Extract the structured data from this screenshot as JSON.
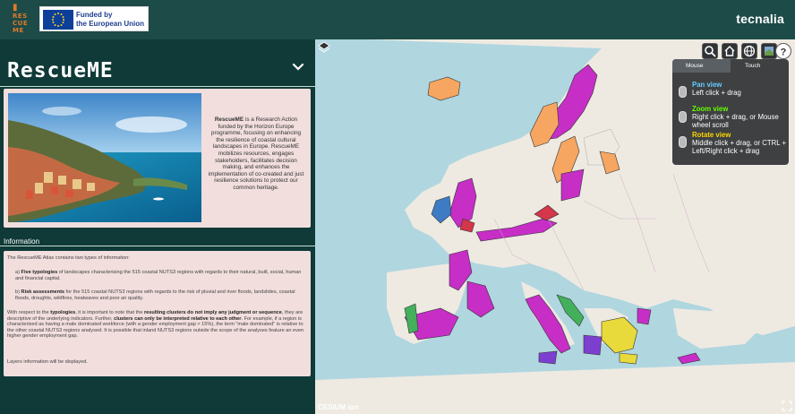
{
  "header": {
    "logo_lines": [
      "RES",
      "CUE",
      "ME"
    ],
    "eu_text_line1": "Funded by",
    "eu_text_line2": "the European Union",
    "partner_brand": "tecnalia"
  },
  "panel": {
    "title": "RescueME",
    "intro": {
      "brand": "RescueME",
      "text": " is a Research Action funded by the Horizon Europe programme, focusing on enhancing the resilience of coastal cultural landscapes in Europe. RescueME mobilizes resources, engages stakeholders, facilitates decision making, and enhances the implementation of co-created and just resilience solutions to protect our common heritage."
    },
    "info_heading": "Information",
    "info": {
      "p1": "The RescueME Atlas contains two types of information:",
      "a_prefix": "a) ",
      "a_bold": "Five typologies",
      "a_text": " of landscapes characterising the 515 coastal NUTS3 regions with regards to their natural, built, social, human and financial capital.",
      "b_prefix": "b) ",
      "b_bold": "Risk assessments",
      "b_text": " for the 515 coastal NUTS3 regions with regards to the risk of pluvial and river floods, landslides, coastal floods, droughts, wildfires, heatwaves and poor air quality.",
      "p4_a": "With respect to the ",
      "p4_b1": "typologies",
      "p4_c": ", it is important to note that the ",
      "p4_b2": "resulting clusters do not imply any judgment or sequence",
      "p4_d": ", they are descriptive of the underlying indicators. Further, ",
      "p4_b3": "clusters can only be interpreted relative to each other",
      "p4_e": ". For example, if a region is characterised as having a male dominated workforce (with a gender employment gap > 15%), the term \"male dominated\" is relative to the other coastal NUTS3 regions analysed. It is possible that inland NUTS3 regions outside the scope of the analyses feature an even higher gender employment gap.",
      "p5": "Layers information will be displayed."
    }
  },
  "map": {
    "toolbar_icons": [
      "search-icon",
      "home-icon",
      "globe-icon",
      "scene-mode-icon",
      "help-icon"
    ],
    "help": {
      "tab_mouse": "Mouse",
      "tab_touch": "Touch",
      "pan_head": "Pan view",
      "pan_text": "Left click + drag",
      "zoom_head": "Zoom view",
      "zoom_text": "Right click + drag, or Mouse wheel scroll",
      "rotate_head": "Rotate view",
      "rotate_text": "Middle click + drag, or CTRL + Left/Right click + drag"
    },
    "attribution": "CESIUM ion",
    "colors": {
      "land": "#eeeae2",
      "sea": "#b0d6e0",
      "orange": "#f6a661",
      "magenta": "#c62ec6",
      "blue": "#3d7cc4",
      "red": "#d4364a",
      "green": "#43b05c",
      "yellow": "#e8da3a",
      "purple": "#7d3fcf"
    }
  }
}
